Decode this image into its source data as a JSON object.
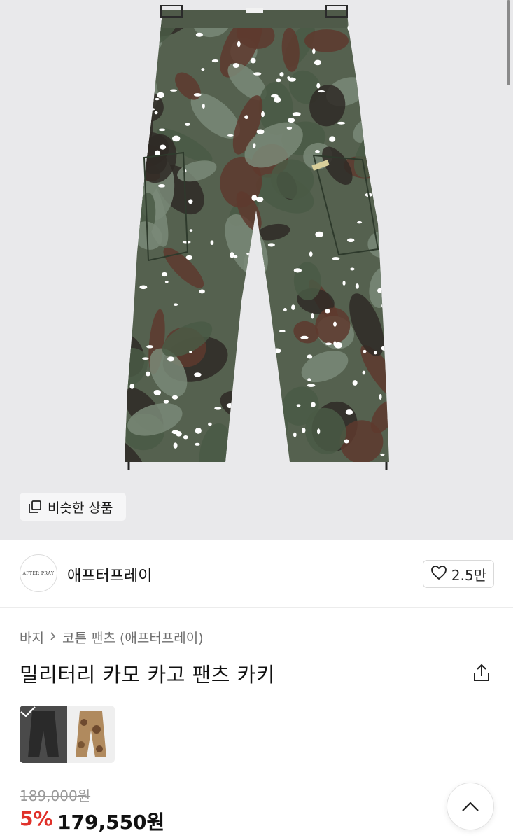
{
  "gallery": {
    "similar_label": "비슷한 상품",
    "background": "#e9e9eb",
    "camo_colors": [
      "#4a5a45",
      "#5e3a2e",
      "#7a8a78",
      "#2f2a26",
      "#ffffff"
    ]
  },
  "brand": {
    "logo_text": "AFTER PRAY",
    "name": "애프터프레이",
    "likes": "2.5만"
  },
  "breadcrumb": {
    "category": "바지",
    "subcategory": "코튼 팬츠 (애프터프레이)"
  },
  "product": {
    "title": "밀리터리 카모 카고 팬츠 카키"
  },
  "options": [
    {
      "color": "dark",
      "selected": true
    },
    {
      "color": "brown-camo",
      "selected": false
    }
  ],
  "price": {
    "original": "189,000원",
    "discount": "5%",
    "sale": "179,550원",
    "discount_color": "#e0312a"
  },
  "icons": {
    "similar": "stacked-squares-icon",
    "like": "heart-icon",
    "share": "share-icon",
    "scroll_top": "chevron-up-icon",
    "breadcrumb_sep": "chevron-right-icon",
    "selected": "check-icon"
  }
}
